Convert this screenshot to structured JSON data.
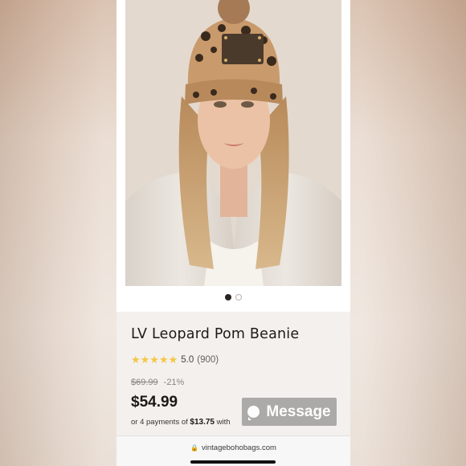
{
  "product": {
    "title": "LV Leopard Pom Beanie",
    "rating_value": "5.0",
    "review_count": "(900)",
    "stars": "★★★★★",
    "original_price": "$69.99",
    "discount": "-21%",
    "price": "$54.99",
    "payments_prefix": "or 4 payments of ",
    "payments_amount": "$13.75",
    "payments_suffix": " with"
  },
  "carousel": {
    "total": 2,
    "active_index": 0
  },
  "overlay": {
    "message_label": "Message"
  },
  "browser": {
    "url": "vintagebohobags.com"
  },
  "colors": {
    "star": "#f4c744",
    "price_text": "#1c1815",
    "message_button": "#a7a5a3"
  }
}
